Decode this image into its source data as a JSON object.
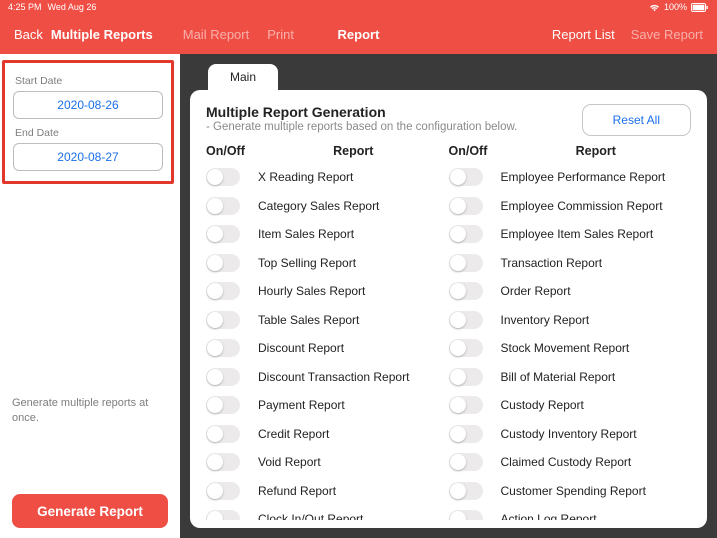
{
  "status_bar": {
    "time": "4:25 PM",
    "date": "Wed Aug 26",
    "battery": "100%"
  },
  "header": {
    "back": "Back",
    "title": "Multiple Reports",
    "mail_report": "Mail Report",
    "print": "Print",
    "center": "Report",
    "report_list": "Report List",
    "save_report": "Save Report"
  },
  "sidebar": {
    "start_label": "Start Date",
    "start_value": "2020-08-26",
    "end_label": "End Date",
    "end_value": "2020-08-27",
    "helper": "Generate multiple reports at once.",
    "generate": "Generate Report"
  },
  "main": {
    "tab": "Main",
    "title": "Multiple Report Generation",
    "subtitle": "- Generate multiple reports based on the configuration below.",
    "reset": "Reset All",
    "col_onoff": "On/Off",
    "col_report": "Report",
    "left_reports": [
      "X Reading Report",
      "Category Sales Report",
      "Item Sales Report",
      "Top Selling Report",
      "Hourly Sales Report",
      "Table Sales Report",
      "Discount Report",
      "Discount Transaction Report",
      "Payment Report",
      "Credit Report",
      "Void Report",
      "Refund Report",
      "Clock In/Out Report"
    ],
    "right_reports": [
      "Employee Performance Report",
      "Employee Commission Report",
      "Employee Item Sales Report",
      "Transaction Report",
      "Order Report",
      "Inventory Report",
      "Stock Movement Report",
      "Bill of Material Report",
      "Custody Report",
      "Custody Inventory Report",
      "Claimed Custody Report",
      "Customer Spending Report",
      "Action Log Report"
    ]
  }
}
